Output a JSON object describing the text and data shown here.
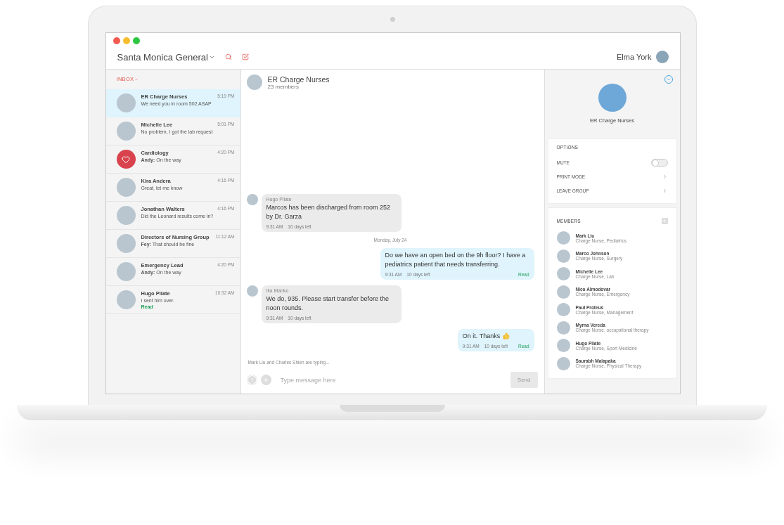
{
  "app": {
    "workspace": "Santa Monica General",
    "user": "Elma York"
  },
  "inbox": {
    "label": "INBOX",
    "conversations": [
      {
        "name": "ER Charge Nurses",
        "time": "5:19 PM",
        "preview": "We need you in room 502 ASAP",
        "kind": "photo",
        "selected": true
      },
      {
        "name": "Michelle Lee",
        "time": "5:01 PM",
        "preview": "No problem, I got the lab request",
        "kind": "photo",
        "selected": false
      },
      {
        "name": "Cardiology",
        "time": "4:20 PM",
        "preview": "**Andy:** On the way",
        "kind": "icon",
        "selected": false
      },
      {
        "name": "Kira Andera",
        "time": "4:16 PM",
        "preview": "Great, let me know",
        "kind": "photo",
        "selected": false
      },
      {
        "name": "Jonathan Walters",
        "time": "4:16 PM",
        "preview": "Did the Leonard results come in?",
        "kind": "photo",
        "selected": false
      },
      {
        "name": "Directors of Nursing Group",
        "time": "11:12 AM",
        "preview": "**Fey:** That should be fine",
        "kind": "photo",
        "selected": false
      },
      {
        "name": "Emergency Lead",
        "time": "4:20 PM",
        "preview": "**Andy:** On the way",
        "kind": "photo",
        "selected": false
      },
      {
        "name": "Hugo Pilate",
        "time": "10:32 AM",
        "preview": "I sent him over.",
        "status": "Read",
        "kind": "photo",
        "selected": false
      }
    ]
  },
  "chat": {
    "title": "ER Charge Nurses",
    "subtitle": "23 members",
    "messages": [
      {
        "kind": "incoming",
        "sender": "Hugo Pilate",
        "text": "Marcos has been discharged from room 252 by Dr. Garza",
        "time": "9:31 AM",
        "expiry": "10 days left"
      },
      {
        "kind": "date",
        "text": "Monday, July 24"
      },
      {
        "kind": "outgoing",
        "text": "Do we have an open bed on the 9h floor? I have a pediatrics patient that needs transferring.",
        "time": "9:31 AM",
        "expiry": "10 days left",
        "status": "Read"
      },
      {
        "kind": "incoming",
        "sender": "Ilia Mariko",
        "text": "We do, 935. Please start transfer before the noon rounds.",
        "time": "9:31 AM",
        "expiry": "10 days left"
      },
      {
        "kind": "outgoing",
        "text": "On it. Thanks",
        "thumbs_up": true,
        "time": "9:31 AM",
        "expiry": "10 days left",
        "status": "Read"
      }
    ],
    "typing": "Mark Liu and Charles Shieh are typing...",
    "composer": {
      "placeholder": "Type message here",
      "send": "Send",
      "send_disabled": true
    }
  },
  "details": {
    "group_name": "ER Charge Nurses",
    "options_title": "OPTIONS",
    "options": [
      {
        "kind": "toggle",
        "label": "MUTE",
        "on": false
      },
      {
        "kind": "link",
        "label": "PRINT MODE"
      },
      {
        "kind": "link",
        "label": "LEAVE GROUP"
      }
    ],
    "members_title": "MEMBERS",
    "members": [
      {
        "name": "Mark Liu",
        "role": "Charge Nurse, Pediatrics"
      },
      {
        "name": "Marco Johnson",
        "role": "Charge Nurse, Surgery"
      },
      {
        "name": "Michelle Lee",
        "role": "Charge Nurse, Lab"
      },
      {
        "name": "Nico Almodovar",
        "role": "Charge Nurse, Emergency"
      },
      {
        "name": "Paul Proteus",
        "role": "Charge Nurse, Management"
      },
      {
        "name": "Myrna Vereda",
        "role": "Charge Nurse, occupational therapy"
      },
      {
        "name": "Hugo Pilate",
        "role": "Charge Nurse, Sport Medicine"
      },
      {
        "name": "Saurabh Malapaka",
        "role": "Charge Nurse, Physical Therapy"
      }
    ]
  }
}
